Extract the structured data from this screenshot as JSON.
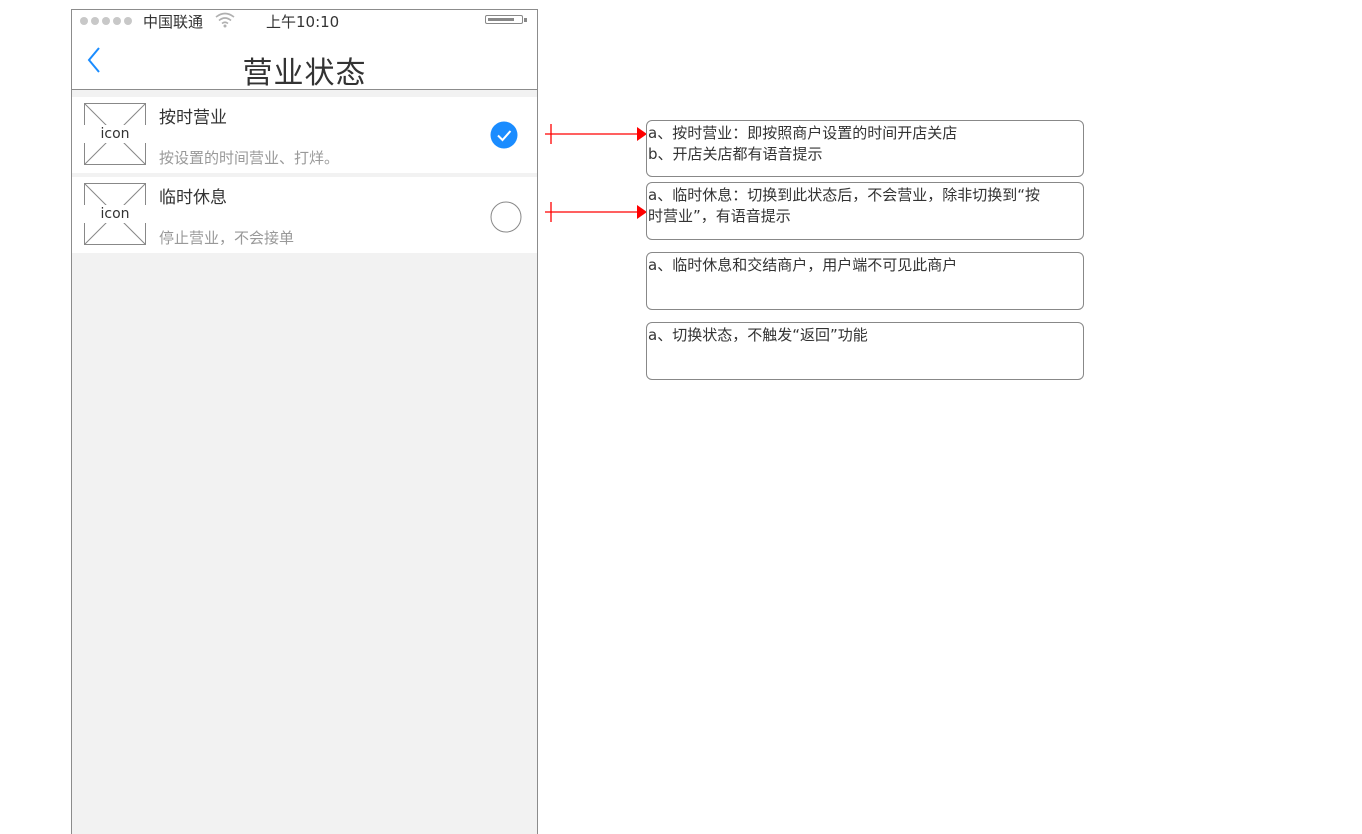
{
  "status_bar": {
    "signal_dots": 5,
    "carrier": "中国联通",
    "time": "上午10:10",
    "battery_level": 0.8
  },
  "nav": {
    "back_icon": "chevron-left-icon",
    "title": "营业状态"
  },
  "options": [
    {
      "title": "按时营业",
      "description": "按设置的时间营业、打烊。",
      "icon_placeholder": "icon",
      "selected": true
    },
    {
      "title": "临时休息",
      "description": "停止营业，不会接单",
      "icon_placeholder": "icon",
      "selected": false
    }
  ],
  "annotations": [
    {
      "lines": [
        " a、按时营业：即按照商户设置的时间开店关店",
        "b、开店关店都有语音提示"
      ]
    },
    {
      "lines": [
        "a、临时休息：切换到此状态后，不会营业，除非切换到“按",
        "时营业”，有语音提示"
      ]
    },
    {
      "lines": [
        "a、临时休息和交结商户，用户端不可见此商户"
      ]
    },
    {
      "lines": [
        "a、切换状态，不触发“返回”功能"
      ]
    }
  ],
  "colors": {
    "accent": "#1a8cff",
    "arrow": "#ff0000",
    "screen_bg": "#f2f2f2"
  }
}
